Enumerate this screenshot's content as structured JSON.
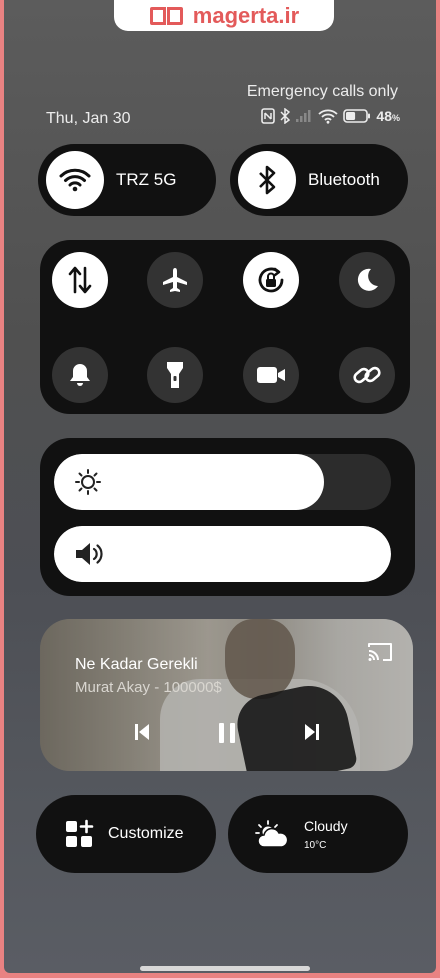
{
  "watermark": {
    "text": "magerta.ir"
  },
  "status_bar": {
    "carrier_text": "Emergency calls only",
    "date": "Thu, Jan 30",
    "battery_percent": "48",
    "battery_unit": "%",
    "battery_level": 0.48
  },
  "connectivity": {
    "wifi_label": "TRZ 5G",
    "bluetooth_label": "Bluetooth"
  },
  "toggles": [
    {
      "icon": "mobile-data-icon",
      "active": true
    },
    {
      "icon": "airplane-icon",
      "active": false
    },
    {
      "icon": "rotation-lock-icon",
      "active": true
    },
    {
      "icon": "moon-icon",
      "active": false
    },
    {
      "icon": "bell-icon",
      "active": false
    },
    {
      "icon": "flashlight-icon",
      "active": false
    },
    {
      "icon": "video-camera-icon",
      "active": false
    },
    {
      "icon": "link-icon",
      "active": false
    }
  ],
  "brightness": {
    "level": 0.8
  },
  "volume": {
    "level": 1.0
  },
  "media": {
    "song_title": "Ne Kadar Gerekli",
    "artist": "Murat Akay - 100000$"
  },
  "customize": {
    "label": "Customize"
  },
  "weather": {
    "condition": "Cloudy",
    "temperature": "10°C"
  },
  "colors": {
    "panel": "#111111",
    "accent": "#ffffff",
    "watermark": "#e35a5a",
    "frame": "#e98282"
  }
}
